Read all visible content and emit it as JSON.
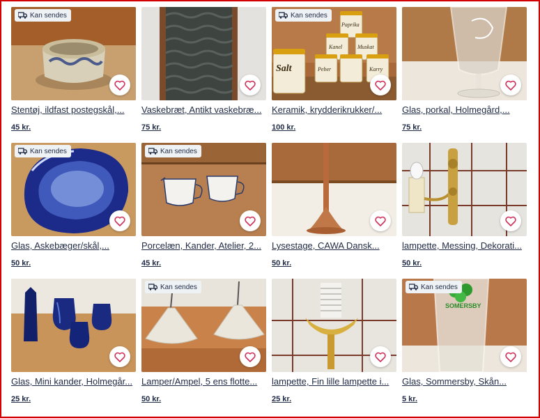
{
  "colors": {
    "text": "#1f2a44",
    "heart": "#d0305a",
    "border": "#d40000",
    "badge_bg": "#eef2f5"
  },
  "ship_badge_icon": "truck-icon",
  "favorite_icon": "heart-icon",
  "listings": [
    {
      "title": "Stentøj, ildfast postegskål,...",
      "price": "45 kr.",
      "badge": "Kan sendes"
    },
    {
      "title": "Vaskebræt, Antikt vaskebræ...",
      "price": "75 kr.",
      "badge": ""
    },
    {
      "title": "Keramik, krydderikrukker/...",
      "price": "100 kr.",
      "badge": "Kan sendes",
      "labels": [
        "Paprika",
        "Kanel",
        "Muskat",
        "Salt",
        "Peber",
        "Karry"
      ]
    },
    {
      "title": "Glas, porkal, Holmegård,...",
      "price": "75 kr.",
      "badge": ""
    },
    {
      "title": "Glas, Askebæger/skål,...",
      "price": "50 kr.",
      "badge": "Kan sendes"
    },
    {
      "title": "Porcelæn, Kander, Atelier, 2...",
      "price": "45 kr.",
      "badge": "Kan sendes"
    },
    {
      "title": "Lysestage, CAWA Dansk...",
      "price": "50 kr.",
      "badge": ""
    },
    {
      "title": "lampette, Messing, Dekorati...",
      "price": "50 kr.",
      "badge": ""
    },
    {
      "title": "Glas, Mini kander, Holmegår...",
      "price": "25 kr.",
      "badge": ""
    },
    {
      "title": "Lamper/Ampel, 5 ens flotte...",
      "price": "50 kr.",
      "badge": "Kan sendes"
    },
    {
      "title": "lampette, Fin lille lampette i...",
      "price": "25 kr.",
      "badge": ""
    },
    {
      "title": "Glas, Sommersby, Skån...",
      "price": "5 kr.",
      "badge": "Kan sendes",
      "brand": "SOMERSBY"
    }
  ]
}
